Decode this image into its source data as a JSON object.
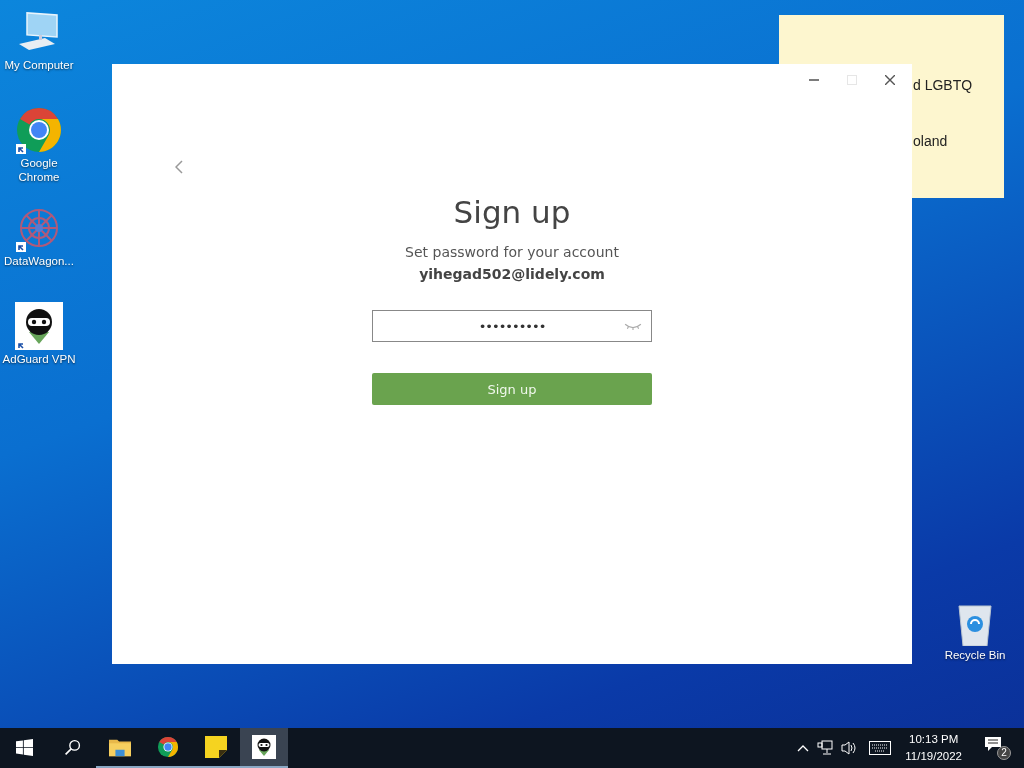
{
  "desktop_icons": [
    {
      "label": "My Computer",
      "kind": "computer",
      "shortcut": false
    },
    {
      "label": "Google Chrome",
      "kind": "chrome",
      "shortcut": true
    },
    {
      "label": "DataWagon...",
      "kind": "datawagon",
      "shortcut": true
    },
    {
      "label": "AdGuard VPN",
      "kind": "adguard",
      "shortcut": true
    }
  ],
  "recycle_bin": {
    "label": "Recycle Bin"
  },
  "sticky_note": {
    "lines": [
      "d LGBTQ",
      "oland"
    ]
  },
  "window": {
    "heading": "Sign up",
    "subtitle": "Set password for your account",
    "email": "yihegad502@lidely.com",
    "password_field": {
      "value": "••••••••••",
      "focused": true
    },
    "submit_button": "Sign up"
  },
  "taskbar": {
    "apps": [
      {
        "kind": "start",
        "running": false,
        "active": false
      },
      {
        "kind": "search",
        "running": false,
        "active": false
      },
      {
        "kind": "explorer",
        "running": true,
        "active": false
      },
      {
        "kind": "chrome",
        "running": true,
        "active": false
      },
      {
        "kind": "sticky",
        "running": true,
        "active": false
      },
      {
        "kind": "adguard",
        "running": true,
        "active": true
      }
    ],
    "time": "10:13 PM",
    "date": "11/19/2022",
    "notification_count": "2"
  }
}
